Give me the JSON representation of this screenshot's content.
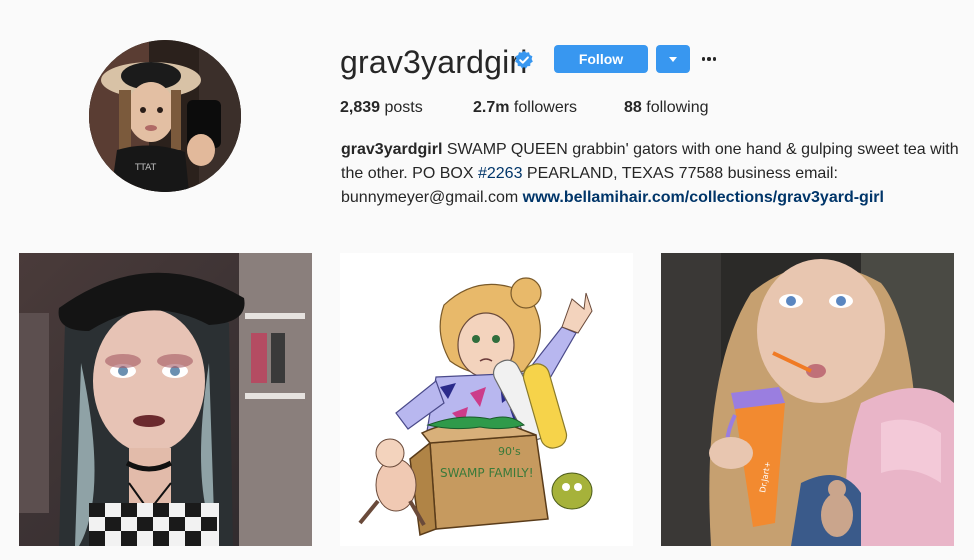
{
  "profile": {
    "username": "grav3yardgirl",
    "verified_icon": "verified-badge-icon",
    "follow_label": "Follow",
    "dropdown_icon": "caret-down-icon",
    "more_icon": "more-options-icon",
    "accent_color": "#3897f0"
  },
  "stats": {
    "posts_count": "2,839",
    "posts_label": "posts",
    "followers_count": "2.7m",
    "followers_label": "followers",
    "following_count": "88",
    "following_label": "following"
  },
  "bio": {
    "name": "grav3yardgirl",
    "text_1": " SWAMP QUEEN grabbin' gators with one hand & gulping sweet tea with the other. PO BOX ",
    "hashtag": "#2263",
    "text_2": " PEARLAND, TEXAS 77588 business email: bunnymeyer@gmail.com ",
    "website": "www.bellamihair.com/collections/grav3yard-girl"
  },
  "posts": [
    {
      "kind": "selfie photo with black beret and necklace"
    },
    {
      "kind": "illustration of girl with swamp family box",
      "box_text": "SWAMP FAMILY!",
      "corner_text": "90's"
    },
    {
      "kind": "selfie photo drinking from orange cup",
      "cup_text": "Dr.Jart+"
    }
  ]
}
